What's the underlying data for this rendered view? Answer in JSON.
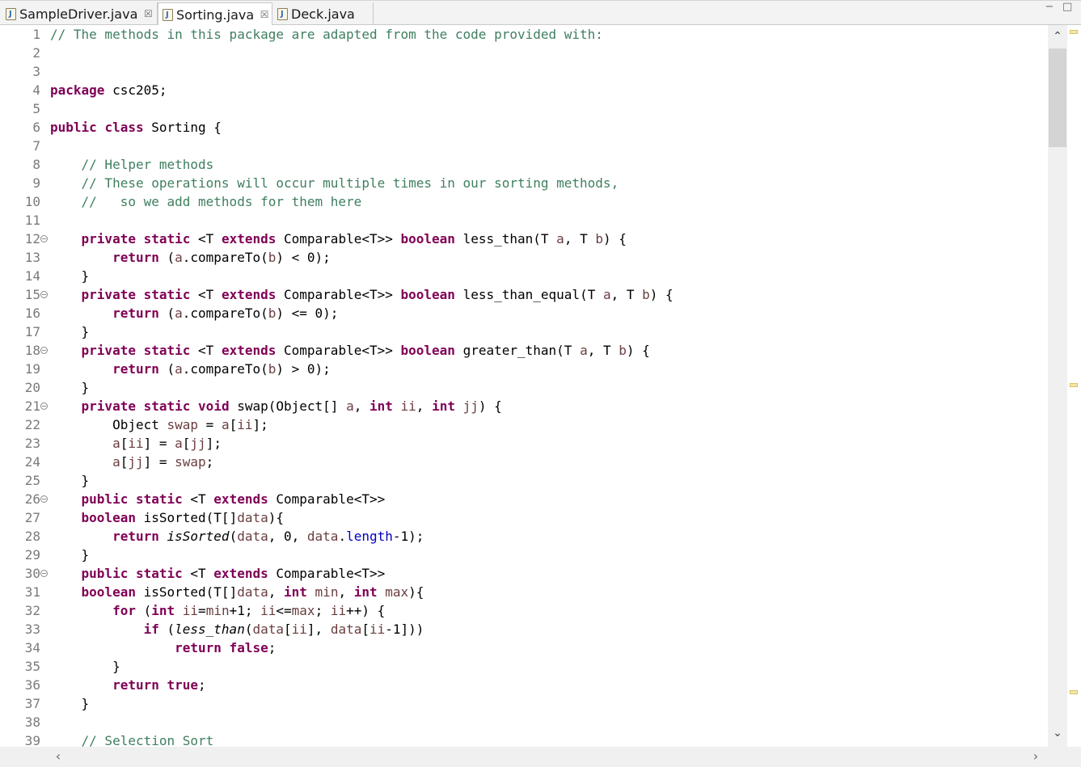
{
  "tabs": [
    {
      "label": "SampleDriver.java",
      "active": false,
      "close": "☒"
    },
    {
      "label": "Sorting.java",
      "active": true,
      "close": "☒"
    },
    {
      "label": "Deck.java",
      "active": false
    }
  ],
  "window_controls": {
    "minimize": "−",
    "maximize": "□"
  },
  "editor": {
    "lines": [
      {
        "n": "1",
        "tokens": [
          [
            "cm",
            "// The methods in this package are adapted from the code provided with:"
          ]
        ]
      },
      {
        "n": "2",
        "tokens": []
      },
      {
        "n": "3",
        "tokens": []
      },
      {
        "n": "4",
        "tokens": [
          [
            "kw",
            "package"
          ],
          [
            "",
            " csc205;"
          ]
        ]
      },
      {
        "n": "5",
        "tokens": []
      },
      {
        "n": "6",
        "tokens": [
          [
            "kw",
            "public"
          ],
          [
            "",
            " "
          ],
          [
            "kw",
            "class"
          ],
          [
            "",
            " Sorting {"
          ]
        ]
      },
      {
        "n": "7",
        "tokens": []
      },
      {
        "n": "8",
        "tokens": [
          [
            "",
            "    "
          ],
          [
            "cm",
            "// Helper methods"
          ]
        ]
      },
      {
        "n": "9",
        "tokens": [
          [
            "",
            "    "
          ],
          [
            "cm",
            "// These operations will occur multiple times in our sorting methods,"
          ]
        ]
      },
      {
        "n": "10",
        "tokens": [
          [
            "",
            "    "
          ],
          [
            "cm",
            "//   so we add methods for them here"
          ]
        ]
      },
      {
        "n": "11",
        "tokens": []
      },
      {
        "n": "12",
        "fold": true,
        "tokens": [
          [
            "",
            "    "
          ],
          [
            "kw",
            "private"
          ],
          [
            "",
            " "
          ],
          [
            "kw",
            "static"
          ],
          [
            "",
            " <T "
          ],
          [
            "kw",
            "extends"
          ],
          [
            "",
            " Comparable<T>> "
          ],
          [
            "kw",
            "boolean"
          ],
          [
            "",
            " less_than(T "
          ],
          [
            "var",
            "a"
          ],
          [
            "",
            ", T "
          ],
          [
            "var",
            "b"
          ],
          [
            "",
            ") {"
          ]
        ]
      },
      {
        "n": "13",
        "tokens": [
          [
            "",
            "        "
          ],
          [
            "kw",
            "return"
          ],
          [
            "",
            " ("
          ],
          [
            "var",
            "a"
          ],
          [
            "",
            ".compareTo("
          ],
          [
            "var",
            "b"
          ],
          [
            "",
            ") < 0);"
          ]
        ]
      },
      {
        "n": "14",
        "tokens": [
          [
            "",
            "    }"
          ]
        ]
      },
      {
        "n": "15",
        "fold": true,
        "tokens": [
          [
            "",
            "    "
          ],
          [
            "kw",
            "private"
          ],
          [
            "",
            " "
          ],
          [
            "kw",
            "static"
          ],
          [
            "",
            " <T "
          ],
          [
            "kw",
            "extends"
          ],
          [
            "",
            " Comparable<T>> "
          ],
          [
            "kw",
            "boolean"
          ],
          [
            "",
            " less_than_equal(T "
          ],
          [
            "var",
            "a"
          ],
          [
            "",
            ", T "
          ],
          [
            "var",
            "b"
          ],
          [
            "",
            ") {"
          ]
        ]
      },
      {
        "n": "16",
        "tokens": [
          [
            "",
            "        "
          ],
          [
            "kw",
            "return"
          ],
          [
            "",
            " ("
          ],
          [
            "var",
            "a"
          ],
          [
            "",
            ".compareTo("
          ],
          [
            "var",
            "b"
          ],
          [
            "",
            ") <= 0);"
          ]
        ]
      },
      {
        "n": "17",
        "tokens": [
          [
            "",
            "    }"
          ]
        ]
      },
      {
        "n": "18",
        "fold": true,
        "tokens": [
          [
            "",
            "    "
          ],
          [
            "kw",
            "private"
          ],
          [
            "",
            " "
          ],
          [
            "kw",
            "static"
          ],
          [
            "",
            " <T "
          ],
          [
            "kw",
            "extends"
          ],
          [
            "",
            " Comparable<T>> "
          ],
          [
            "kw",
            "boolean"
          ],
          [
            "",
            " greater_than(T "
          ],
          [
            "var",
            "a"
          ],
          [
            "",
            ", T "
          ],
          [
            "var",
            "b"
          ],
          [
            "",
            ") {"
          ]
        ]
      },
      {
        "n": "19",
        "tokens": [
          [
            "",
            "        "
          ],
          [
            "kw",
            "return"
          ],
          [
            "",
            " ("
          ],
          [
            "var",
            "a"
          ],
          [
            "",
            ".compareTo("
          ],
          [
            "var",
            "b"
          ],
          [
            "",
            ") > 0);"
          ]
        ]
      },
      {
        "n": "20",
        "tokens": [
          [
            "",
            "    }"
          ]
        ]
      },
      {
        "n": "21",
        "fold": true,
        "tokens": [
          [
            "",
            "    "
          ],
          [
            "kw",
            "private"
          ],
          [
            "",
            " "
          ],
          [
            "kw",
            "static"
          ],
          [
            "",
            " "
          ],
          [
            "kw",
            "void"
          ],
          [
            "",
            " swap(Object[] "
          ],
          [
            "var",
            "a"
          ],
          [
            "",
            ", "
          ],
          [
            "kw",
            "int"
          ],
          [
            "",
            " "
          ],
          [
            "var",
            "ii"
          ],
          [
            "",
            ", "
          ],
          [
            "kw",
            "int"
          ],
          [
            "",
            " "
          ],
          [
            "var",
            "jj"
          ],
          [
            "",
            ") {"
          ]
        ]
      },
      {
        "n": "22",
        "tokens": [
          [
            "",
            "        Object "
          ],
          [
            "var",
            "swap"
          ],
          [
            "",
            " = "
          ],
          [
            "var",
            "a"
          ],
          [
            "",
            "["
          ],
          [
            "var",
            "ii"
          ],
          [
            "",
            "];"
          ]
        ]
      },
      {
        "n": "23",
        "tokens": [
          [
            "",
            "        "
          ],
          [
            "var",
            "a"
          ],
          [
            "",
            "["
          ],
          [
            "var",
            "ii"
          ],
          [
            "",
            "] = "
          ],
          [
            "var",
            "a"
          ],
          [
            "",
            "["
          ],
          [
            "var",
            "jj"
          ],
          [
            "",
            "];"
          ]
        ]
      },
      {
        "n": "24",
        "tokens": [
          [
            "",
            "        "
          ],
          [
            "var",
            "a"
          ],
          [
            "",
            "["
          ],
          [
            "var",
            "jj"
          ],
          [
            "",
            "] = "
          ],
          [
            "var",
            "swap"
          ],
          [
            "",
            ";"
          ]
        ]
      },
      {
        "n": "25",
        "tokens": [
          [
            "",
            "    }"
          ]
        ]
      },
      {
        "n": "26",
        "fold": true,
        "tokens": [
          [
            "",
            "    "
          ],
          [
            "kw",
            "public"
          ],
          [
            "",
            " "
          ],
          [
            "kw",
            "static"
          ],
          [
            "",
            " <T "
          ],
          [
            "kw",
            "extends"
          ],
          [
            "",
            " Comparable<T>>"
          ]
        ]
      },
      {
        "n": "27",
        "tokens": [
          [
            "",
            "    "
          ],
          [
            "kw",
            "boolean"
          ],
          [
            "",
            " isSorted(T[]"
          ],
          [
            "var",
            "data"
          ],
          [
            "",
            "){"
          ]
        ]
      },
      {
        "n": "28",
        "tokens": [
          [
            "",
            "        "
          ],
          [
            "kw",
            "return"
          ],
          [
            "",
            " "
          ],
          [
            "it",
            "isSorted"
          ],
          [
            "",
            "("
          ],
          [
            "var",
            "data"
          ],
          [
            "",
            ", 0, "
          ],
          [
            "var",
            "data"
          ],
          [
            "",
            "."
          ],
          [
            "fld",
            "length"
          ],
          [
            "",
            "-1);"
          ]
        ]
      },
      {
        "n": "29",
        "tokens": [
          [
            "",
            "    }"
          ]
        ]
      },
      {
        "n": "30",
        "fold": true,
        "tokens": [
          [
            "",
            "    "
          ],
          [
            "kw",
            "public"
          ],
          [
            "",
            " "
          ],
          [
            "kw",
            "static"
          ],
          [
            "",
            " <T "
          ],
          [
            "kw",
            "extends"
          ],
          [
            "",
            " Comparable<T>>"
          ]
        ]
      },
      {
        "n": "31",
        "tokens": [
          [
            "",
            "    "
          ],
          [
            "kw",
            "boolean"
          ],
          [
            "",
            " isSorted(T[]"
          ],
          [
            "var",
            "data"
          ],
          [
            "",
            ", "
          ],
          [
            "kw",
            "int"
          ],
          [
            "",
            " "
          ],
          [
            "var",
            "min"
          ],
          [
            "",
            ", "
          ],
          [
            "kw",
            "int"
          ],
          [
            "",
            " "
          ],
          [
            "var",
            "max"
          ],
          [
            "",
            "){"
          ]
        ]
      },
      {
        "n": "32",
        "tokens": [
          [
            "",
            "        "
          ],
          [
            "kw",
            "for"
          ],
          [
            "",
            " ("
          ],
          [
            "kw",
            "int"
          ],
          [
            "",
            " "
          ],
          [
            "var",
            "ii"
          ],
          [
            "",
            "="
          ],
          [
            "var",
            "min"
          ],
          [
            "",
            "+1; "
          ],
          [
            "var",
            "ii"
          ],
          [
            "",
            "<="
          ],
          [
            "var",
            "max"
          ],
          [
            "",
            "; "
          ],
          [
            "var",
            "ii"
          ],
          [
            "",
            "++) {"
          ]
        ]
      },
      {
        "n": "33",
        "tokens": [
          [
            "",
            "            "
          ],
          [
            "kw",
            "if"
          ],
          [
            "",
            " ("
          ],
          [
            "it",
            "less_than"
          ],
          [
            "",
            "("
          ],
          [
            "var",
            "data"
          ],
          [
            "",
            "["
          ],
          [
            "var",
            "ii"
          ],
          [
            "",
            "], "
          ],
          [
            "var",
            "data"
          ],
          [
            "",
            "["
          ],
          [
            "var",
            "ii"
          ],
          [
            "",
            "-1]))"
          ]
        ]
      },
      {
        "n": "34",
        "tokens": [
          [
            "",
            "                "
          ],
          [
            "kw",
            "return"
          ],
          [
            "",
            " "
          ],
          [
            "kw",
            "false"
          ],
          [
            "",
            ";"
          ]
        ]
      },
      {
        "n": "35",
        "tokens": [
          [
            "",
            "        }"
          ]
        ]
      },
      {
        "n": "36",
        "tokens": [
          [
            "",
            "        "
          ],
          [
            "kw",
            "return"
          ],
          [
            "",
            " "
          ],
          [
            "kw",
            "true"
          ],
          [
            "",
            ";"
          ]
        ]
      },
      {
        "n": "37",
        "tokens": [
          [
            "",
            "    }"
          ]
        ]
      },
      {
        "n": "38",
        "tokens": []
      },
      {
        "n": "39",
        "tokens": [
          [
            "",
            "    "
          ],
          [
            "cm",
            "// Selection Sort"
          ]
        ]
      }
    ]
  },
  "scrollbar": {
    "up_arrow": "⌃",
    "down_arrow": "⌄",
    "left_arrow": "‹",
    "right_arrow": "›"
  },
  "colors": {
    "keyword": "#7f0055",
    "comment": "#3f7f5f",
    "field": "#0000c0",
    "variable": "#6a3e3e"
  }
}
